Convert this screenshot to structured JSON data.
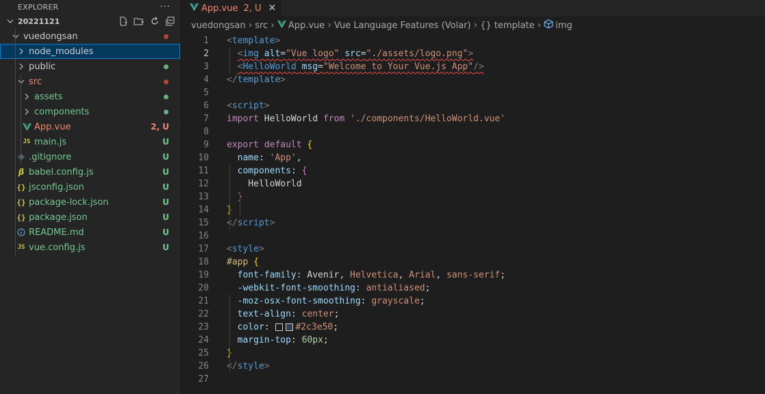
{
  "explorer": {
    "title": "EXPLORER",
    "more": "···",
    "root": "20221121",
    "items": [
      {
        "label": "vuedongsan",
        "type": "folder",
        "expanded": true,
        "depth": 1,
        "status": "dot",
        "color": "#c74e39"
      },
      {
        "label": "node_modules",
        "type": "folder",
        "expanded": false,
        "depth": 2,
        "status": "none",
        "selected": true
      },
      {
        "label": "public",
        "type": "folder",
        "expanded": false,
        "depth": 2,
        "status": "dot",
        "color": "#73c991"
      },
      {
        "label": "src",
        "type": "folder",
        "expanded": true,
        "depth": 2,
        "status": "dot",
        "color": "#c74e39",
        "labelColor": "#f48771"
      },
      {
        "label": "assets",
        "type": "folder",
        "expanded": false,
        "depth": 3,
        "status": "dot",
        "color": "#73c991",
        "labelColor": "#73c991"
      },
      {
        "label": "components",
        "type": "folder",
        "expanded": false,
        "depth": 3,
        "status": "dot",
        "color": "#73c991",
        "labelColor": "#73c991"
      },
      {
        "label": "App.vue",
        "type": "vue",
        "depth": 3,
        "badge": "2, U",
        "labelColor": "#f48771"
      },
      {
        "label": "main.js",
        "type": "js",
        "depth": 3,
        "badge": "U",
        "labelColor": "#73c991"
      },
      {
        "label": ".gitignore",
        "type": "git",
        "depth": 2,
        "badge": "U",
        "labelColor": "#73c991"
      },
      {
        "label": "babel.config.js",
        "type": "babel",
        "depth": 2,
        "badge": "U",
        "labelColor": "#73c991"
      },
      {
        "label": "jsconfig.json",
        "type": "json",
        "depth": 2,
        "badge": "U",
        "labelColor": "#73c991"
      },
      {
        "label": "package-lock.json",
        "type": "json",
        "depth": 2,
        "badge": "U",
        "labelColor": "#73c991"
      },
      {
        "label": "package.json",
        "type": "json",
        "depth": 2,
        "badge": "U",
        "labelColor": "#73c991"
      },
      {
        "label": "README.md",
        "type": "info",
        "depth": 2,
        "badge": "U",
        "labelColor": "#73c991"
      },
      {
        "label": "vue.config.js",
        "type": "js",
        "depth": 2,
        "badge": "U",
        "labelColor": "#73c991"
      }
    ]
  },
  "tab": {
    "label": "App.vue",
    "badge": "2, U"
  },
  "breadcrumbs": [
    "vuedongsan",
    "src",
    "App.vue",
    "Vue Language Features (Volar)",
    "{} template",
    "img"
  ],
  "editor": {
    "current_line": 2,
    "lines": [
      [
        [
          "<",
          "t-tag"
        ],
        [
          "template",
          "t-tagname"
        ],
        [
          ">",
          "t-tag"
        ]
      ],
      [
        [
          "  ",
          ""
        ],
        [
          "<",
          "t-tag"
        ],
        [
          "img",
          "t-tagname"
        ],
        [
          " ",
          ""
        ],
        [
          "alt",
          "t-attr"
        ],
        [
          "=",
          ""
        ],
        [
          "\"Vue logo\"",
          "t-str"
        ],
        [
          " ",
          ""
        ],
        [
          "src",
          "t-attr"
        ],
        [
          "=",
          ""
        ],
        [
          "\"./assets/logo.png\"",
          "t-str"
        ],
        [
          ">",
          "t-tag"
        ]
      ],
      [
        [
          "  ",
          ""
        ],
        [
          "<",
          "t-tag"
        ],
        [
          "HelloWorld",
          "t-tagname"
        ],
        [
          " ",
          ""
        ],
        [
          "msg",
          "t-attr"
        ],
        [
          "=",
          ""
        ],
        [
          "\"Welcome to Your Vue.js App\"",
          "t-str"
        ],
        [
          "/>",
          "t-tag"
        ]
      ],
      [
        [
          "</",
          "t-tag"
        ],
        [
          "template",
          "t-tagname"
        ],
        [
          ">",
          "t-tag"
        ]
      ],
      [],
      [
        [
          "<",
          "t-tag"
        ],
        [
          "script",
          "t-tagname"
        ],
        [
          ">",
          "t-tag"
        ]
      ],
      [
        [
          "import",
          "t-kw"
        ],
        [
          " HelloWorld ",
          ""
        ],
        [
          "from",
          "t-kw"
        ],
        [
          " ",
          ""
        ],
        [
          "'./components/HelloWorld.vue'",
          "t-str"
        ]
      ],
      [],
      [
        [
          "export",
          "t-kw"
        ],
        [
          " ",
          ""
        ],
        [
          "default",
          "t-kw"
        ],
        [
          " ",
          ""
        ],
        [
          "{",
          "t-brace1"
        ]
      ],
      [
        [
          "  ",
          ""
        ],
        [
          "name",
          "t-prop"
        ],
        [
          ": ",
          ""
        ],
        [
          "'App'",
          "t-str"
        ],
        [
          ",",
          ""
        ]
      ],
      [
        [
          "  ",
          ""
        ],
        [
          "components",
          "t-prop"
        ],
        [
          ": ",
          ""
        ],
        [
          "{",
          "t-brace2"
        ]
      ],
      [
        [
          "    HelloWorld",
          ""
        ]
      ],
      [
        [
          "  ",
          ""
        ],
        [
          "}",
          "t-brace2"
        ]
      ],
      [
        [
          "}",
          "t-brace1"
        ]
      ],
      [
        [
          "</",
          "t-tag"
        ],
        [
          "script",
          "t-tagname"
        ],
        [
          ">",
          "t-tag"
        ]
      ],
      [],
      [
        [
          "<",
          "t-tag"
        ],
        [
          "style",
          "t-tagname"
        ],
        [
          ">",
          "t-tag"
        ]
      ],
      [
        [
          "#app",
          "t-class"
        ],
        [
          " ",
          ""
        ],
        [
          "{",
          "t-brace1"
        ]
      ],
      [
        [
          "  ",
          ""
        ],
        [
          "font-family",
          "t-prop"
        ],
        [
          ": Avenir, ",
          ""
        ],
        [
          "Helvetica",
          "t-str"
        ],
        [
          ", ",
          ""
        ],
        [
          "Arial",
          "t-str"
        ],
        [
          ", ",
          ""
        ],
        [
          "sans-serif",
          "t-str"
        ],
        [
          ";",
          ""
        ]
      ],
      [
        [
          "  ",
          ""
        ],
        [
          "-webkit-font-smoothing",
          "t-prop"
        ],
        [
          ": ",
          ""
        ],
        [
          "antialiased",
          "t-str"
        ],
        [
          ";",
          ""
        ]
      ],
      [
        [
          "  ",
          ""
        ],
        [
          "-moz-osx-font-smoothing",
          "t-prop"
        ],
        [
          ": ",
          ""
        ],
        [
          "grayscale",
          "t-str"
        ],
        [
          ";",
          ""
        ]
      ],
      [
        [
          "  ",
          ""
        ],
        [
          "text-align",
          "t-prop"
        ],
        [
          ": ",
          ""
        ],
        [
          "center",
          "t-str"
        ],
        [
          ";",
          ""
        ]
      ],
      [
        [
          "  ",
          ""
        ],
        [
          "color",
          "t-prop"
        ],
        [
          ": ",
          ""
        ],
        [
          "SWATCH",
          ""
        ],
        [
          "#2c3e50",
          "t-str"
        ],
        [
          ";",
          ""
        ]
      ],
      [
        [
          "  ",
          ""
        ],
        [
          "margin-top",
          "t-prop"
        ],
        [
          ": ",
          ""
        ],
        [
          "60px",
          "t-num"
        ],
        [
          ";",
          ""
        ]
      ],
      [
        [
          "}",
          "t-brace1"
        ]
      ],
      [
        [
          "</",
          "t-tag"
        ],
        [
          "style",
          "t-tagname"
        ],
        [
          ">",
          "t-tag"
        ]
      ],
      []
    ]
  }
}
